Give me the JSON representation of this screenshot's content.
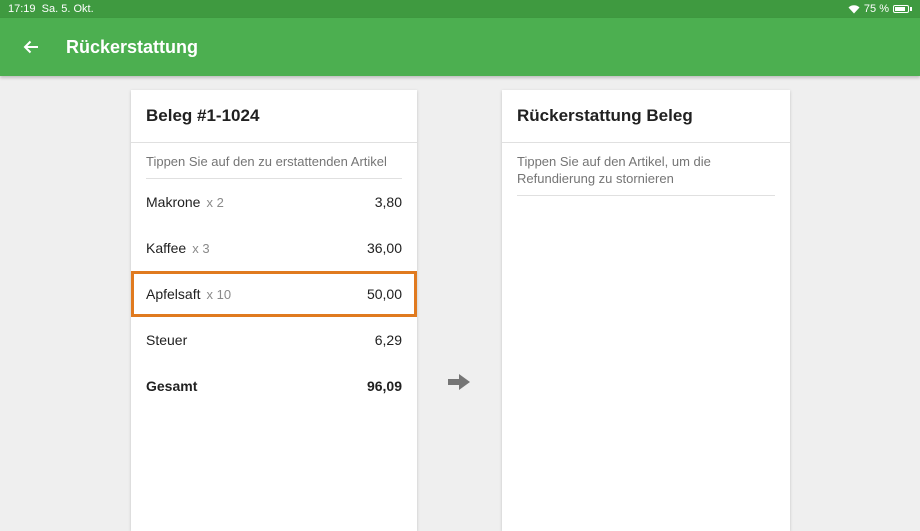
{
  "status": {
    "time": "17:19",
    "date": "Sa. 5. Okt.",
    "battery": "75 %"
  },
  "appbar": {
    "title": "Rückerstattung",
    "back_icon": "arrow-left-icon"
  },
  "receipt": {
    "title": "Beleg #1-1024",
    "hint": "Tippen Sie auf den zu erstattenden Artikel",
    "items": [
      {
        "name": "Makrone",
        "qty": "x 2",
        "amount": "3,80"
      },
      {
        "name": "Kaffee",
        "qty": "x 3",
        "amount": "36,00"
      },
      {
        "name": "Apfelsaft",
        "qty": "x 10",
        "amount": "50,00"
      }
    ],
    "tax": {
      "label": "Steuer",
      "amount": "6,29"
    },
    "total": {
      "label": "Gesamt",
      "amount": "96,09"
    }
  },
  "refund": {
    "title": "Rückerstattung Beleg",
    "hint": "Tippen Sie auf den Artikel, um die Refundierung zu stornieren"
  },
  "colors": {
    "appbar": "#4caf50",
    "statusbar": "#3f9a40",
    "highlight": "#e07a1f"
  }
}
